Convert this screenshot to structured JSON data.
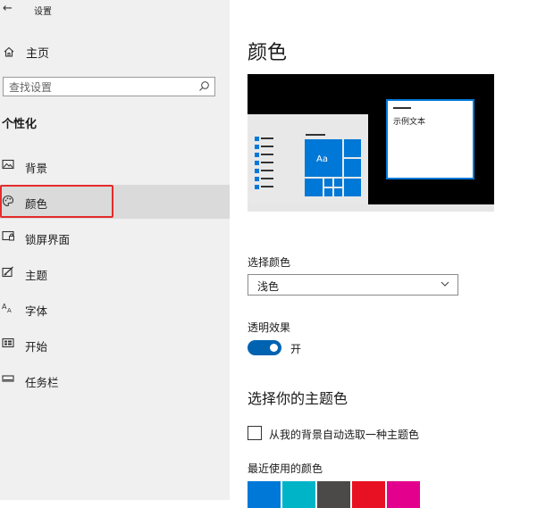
{
  "window": {
    "title": "设置",
    "back_icon": "back-arrow-icon"
  },
  "sidebar": {
    "home_label": "主页",
    "search": {
      "placeholder": "查找设置"
    },
    "section_title": "个性化",
    "items": [
      {
        "label": "背景",
        "icon": "picture-icon"
      },
      {
        "label": "颜色",
        "icon": "palette-icon",
        "selected": true
      },
      {
        "label": "锁屏界面",
        "icon": "lock-screen-icon"
      },
      {
        "label": "主题",
        "icon": "theme-brush-icon"
      },
      {
        "label": "字体",
        "icon": "font-icon"
      },
      {
        "label": "开始",
        "icon": "start-menu-icon"
      },
      {
        "label": "任务栏",
        "icon": "taskbar-icon"
      }
    ]
  },
  "main": {
    "title": "颜色",
    "preview": {
      "sample_text": "示例文本",
      "tile_text": "Aa",
      "accent": "#0078d7"
    },
    "choose_color": {
      "label": "选择颜色",
      "value": "浅色"
    },
    "transparency": {
      "label": "透明效果",
      "state": "开",
      "on": true
    },
    "accent_heading": "选择你的主题色",
    "auto_pick": {
      "label": "从我的背景自动选取一种主题色",
      "checked": false
    },
    "recent_colors": {
      "label": "最近使用的颜色",
      "swatches": [
        "#0078d7",
        "#00b4c8",
        "#4c4a48",
        "#e81123",
        "#e3008c"
      ]
    }
  }
}
